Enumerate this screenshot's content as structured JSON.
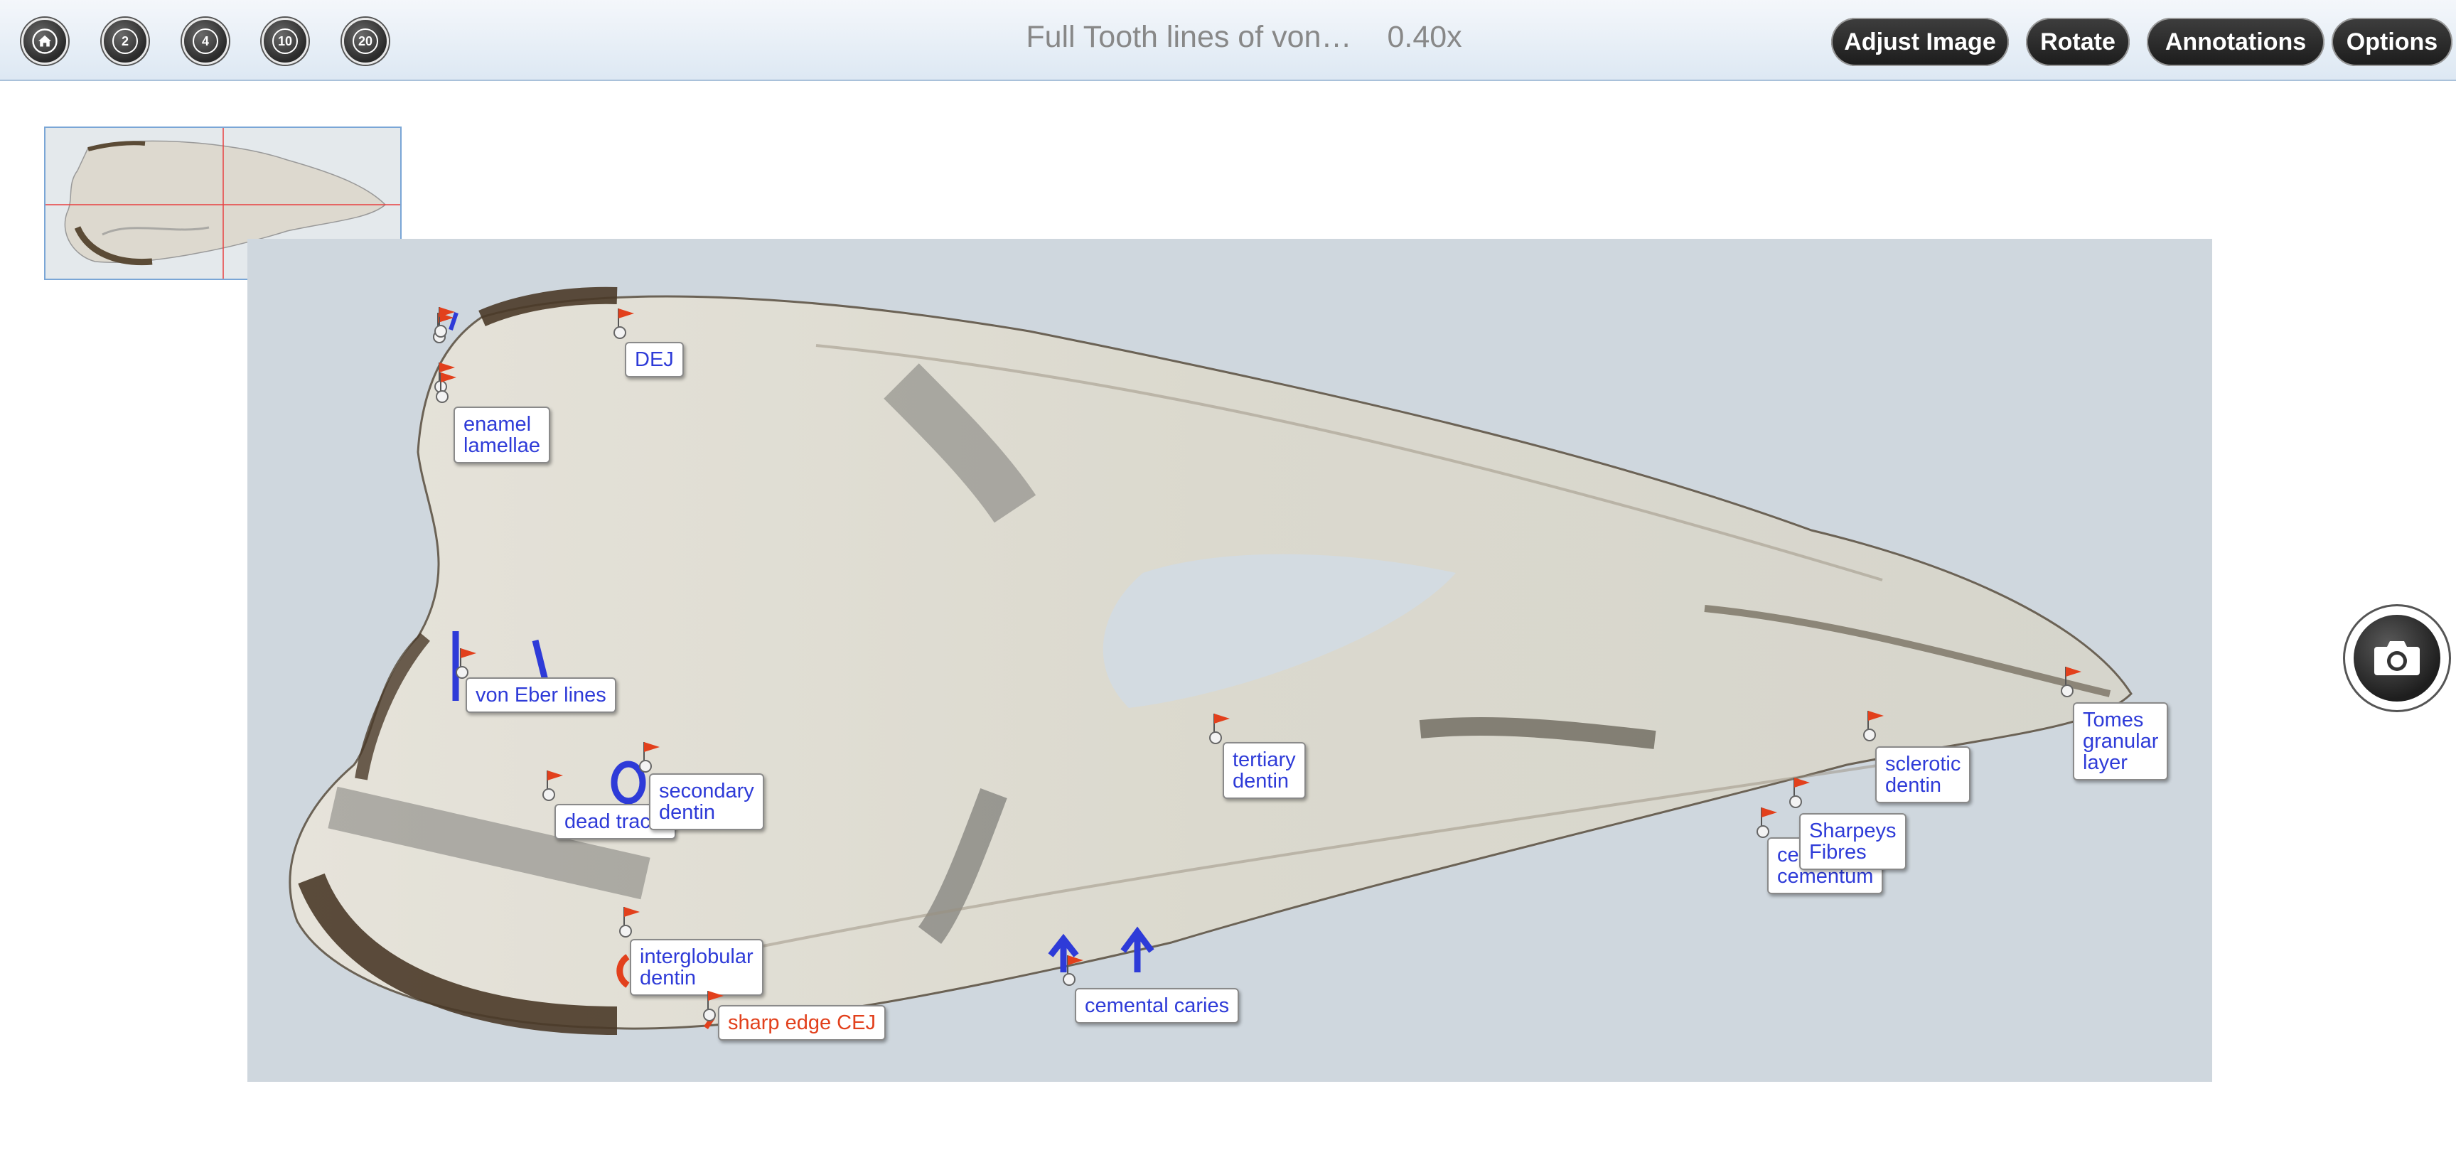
{
  "toolbar": {
    "zoom_buttons": [
      "2",
      "4",
      "10",
      "20"
    ],
    "title": "Full Tooth lines of von…",
    "magnification": "0.40x",
    "buttons": {
      "adjust_image": "Adjust Image",
      "rotate": "Rotate",
      "annotations": "Annotations",
      "options": "Options"
    }
  },
  "annotations": {
    "dej": "DEJ",
    "enamel_lamellae": [
      "enamel",
      "lamellae"
    ],
    "von_eber_lines": "von Eber lines",
    "dead_tracts": "dead tracts",
    "secondary_dentin": [
      "secondary",
      "dentin"
    ],
    "tertiary_dentin": [
      "tertiary",
      "dentin"
    ],
    "interglobular_dentin": [
      "interglobular",
      "dentin"
    ],
    "sharp_edge_cej": "sharp edge CEJ",
    "cemental_caries": "cemental caries",
    "cellular_cementum": [
      "cellular",
      "cementum"
    ],
    "sharpeys_fibres": [
      "Sharpeys",
      "Fibres"
    ],
    "sclerotic_dentin": [
      "sclerotic",
      "dentin"
    ],
    "tomes_granular_layer": [
      "Tomes",
      "granular",
      "layer"
    ]
  },
  "colors": {
    "label_text": "#2e3bd8",
    "label_text_red": "#e2401c",
    "pin_flag": "#e2401c",
    "toolbar_bg": "#dde8f3"
  }
}
